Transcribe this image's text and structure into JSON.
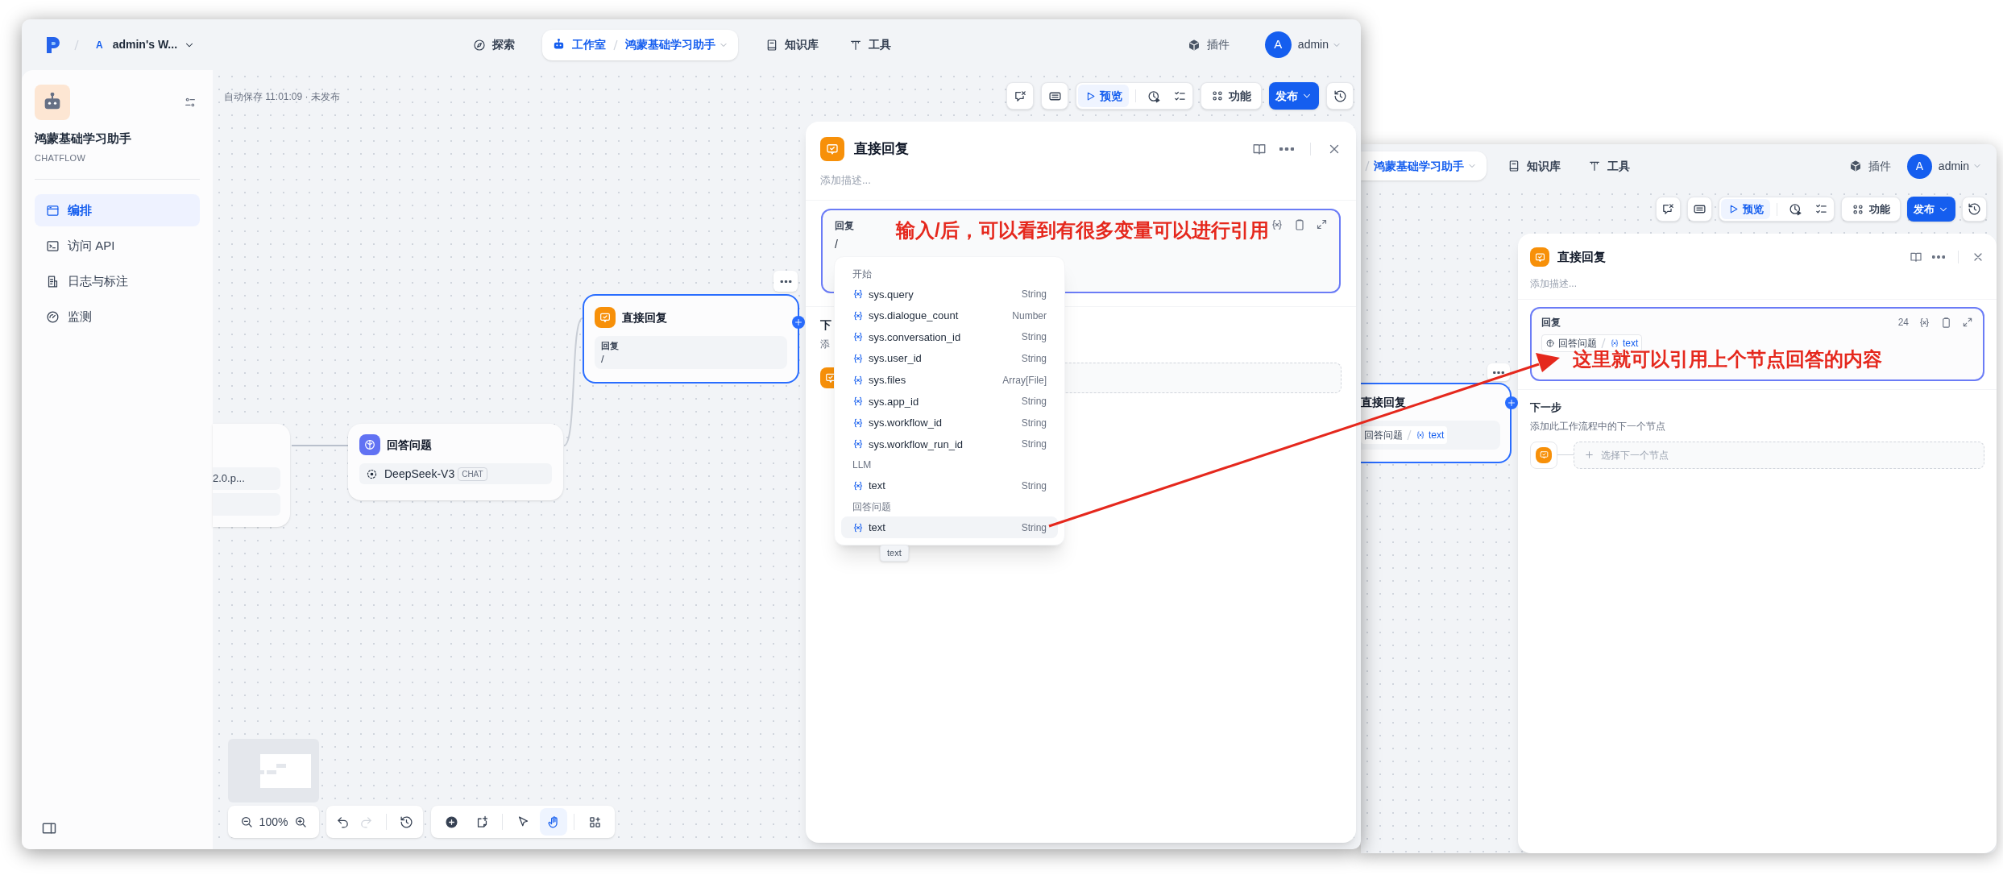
{
  "left_window": {
    "top_bar": {
      "workspace_initial": "A",
      "workspace": "admin's W...",
      "nav": [
        {
          "label": "探索",
          "selected": false
        },
        {
          "label": "工作室",
          "selected": true,
          "breadcrumb": "鸿蒙基础学习助手"
        },
        {
          "label": "知识库",
          "selected": false
        },
        {
          "label": "工具",
          "selected": false
        }
      ],
      "plugins": "插件",
      "avatar": "A",
      "user": "admin"
    },
    "sidebar": {
      "app_name": "鸿蒙基础学习助手",
      "app_type": "CHATFLOW",
      "items": [
        {
          "label": "编排",
          "selected": true
        },
        {
          "label": "访问 API",
          "selected": false
        },
        {
          "label": "日志与标注",
          "selected": false
        },
        {
          "label": "监测",
          "selected": false
        }
      ]
    },
    "canvas": {
      "autosave": "自动保存 11:01:09 · 未发布",
      "toolbar": {
        "preview": "预览",
        "features": "功能",
        "publish": "发布"
      },
      "nodes": [
        {
          "kind": "partial",
          "rows": [
            "2.0.p..."
          ]
        },
        {
          "kind": "llm",
          "title": "回答问题",
          "model": "DeepSeek-V3",
          "mode": "CHAT"
        },
        {
          "kind": "answer",
          "title": "直接回复",
          "selected": true,
          "field_label": "回复",
          "field_value": "/"
        }
      ],
      "zoom": "100%",
      "history": [
        {
          "disabled": false
        },
        {
          "disabled": true
        }
      ],
      "tools": [
        {
          "selected": false
        },
        {
          "selected": false
        },
        {
          "selected": false
        },
        {
          "selected": true
        },
        {
          "selected": false
        }
      ]
    },
    "panel": {
      "title": "直接回复",
      "description_placeholder": "添加描述...",
      "field": {
        "label": "回复",
        "value": "/"
      },
      "next_step": {
        "title": "下",
        "description": "添"
      },
      "variable_menu": {
        "groups": [
          {
            "title": "开始",
            "items": [
              {
                "name": "sys.query",
                "type": "String",
                "selected": false
              },
              {
                "name": "sys.dialogue_count",
                "type": "Number",
                "selected": false
              },
              {
                "name": "sys.conversation_id",
                "type": "String",
                "selected": false
              },
              {
                "name": "sys.user_id",
                "type": "String",
                "selected": false
              },
              {
                "name": "sys.files",
                "type": "Array[File]",
                "selected": false
              },
              {
                "name": "sys.app_id",
                "type": "String",
                "selected": false
              },
              {
                "name": "sys.workflow_id",
                "type": "String",
                "selected": false
              },
              {
                "name": "sys.workflow_run_id",
                "type": "String",
                "selected": false
              }
            ]
          },
          {
            "title": "LLM",
            "items": [
              {
                "name": "text",
                "type": "String",
                "selected": false
              }
            ]
          },
          {
            "title": "回答问题",
            "items": [
              {
                "name": "text",
                "type": "String",
                "selected": true
              }
            ]
          }
        ]
      },
      "tooltip": "text"
    }
  },
  "right_window": {
    "top_bar": {
      "breadcrumb": "鸿蒙基础学习助手",
      "nav": [
        "知识库",
        "工具"
      ],
      "plugins": "插件",
      "avatar": "A",
      "user": "admin"
    },
    "toolbar": {
      "preview": "预览",
      "features": "功能",
      "publish": "发布"
    },
    "node": {
      "title": "直接回复",
      "selected": true,
      "ref_node": "回答问题",
      "ref_var": "text"
    },
    "panel": {
      "title": "直接回复",
      "description_placeholder": "添加描述...",
      "field": {
        "label": "回复",
        "count": "24",
        "ref_node": "回答问题",
        "ref_var": "text"
      },
      "next_step": {
        "title": "下一步",
        "description": "添加此工作流程中的下一个节点",
        "placeholder": "选择下一个节点"
      }
    }
  },
  "annotations": [
    {
      "text": "输入/后，可以看到有很多变量可以进行引用"
    },
    {
      "text": "这里就可以引用上个节点回答的内容"
    }
  ]
}
